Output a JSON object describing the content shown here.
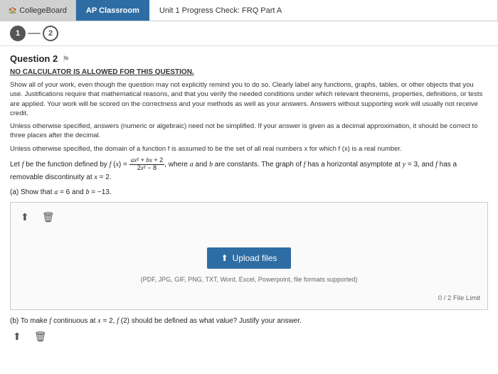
{
  "topbar": {
    "tab1_label": "CollegeBoard",
    "tab2_label": "AP Classroom",
    "tab3_label": "Unit 1 Progress Check: FRQ Part A"
  },
  "steps": {
    "step1_label": "1",
    "step2_label": "2"
  },
  "question": {
    "number": "Question 2",
    "no_calc": "NO CALCULATOR IS ALLOWED FOR THIS QUESTION.",
    "instruction1": "Show all of your work, even though the question may not explicitly remind you to do so. Clearly label any functions, graphs, tables, or other objects that you use. Justifications require that mathematical reasons, and that you verify the needed conditions under which relevant theorems, properties, definitions, or tests are applied. Your work will be scored on the correctness and your methods as well as your answers. Answers without supporting work will usually not receive credit.",
    "instruction2": "Unless otherwise specified, answers (numeric or algebraic) need not be simplified. If your answer is given as a decimal approximation, it should be correct to three places after the decimal.",
    "instruction3": "Unless otherwise specified, the domain of a function f is assumed to be the set of all real numbers x for which f (x) is a real number.",
    "function_desc": "Let f be the function defined by f (x) = (ax² + bx + 2) / (2x² - 8), where a and b are constants. The graph of f has a horizontal asymptote at y = 3, and f has a removable discontinuity at x = 2.",
    "part_a_label": "(a) Show that a = 6 and b = −13.",
    "part_b_label": "(b) To make f continuous at x = 2, f (2) should be defined as what value? Justify your answer."
  },
  "upload": {
    "btn_label": "Upload files",
    "formats_text": "(PDF, JPG, GIF, PNG, TXT, Word, Excel, Powerpoint, file formats supported)",
    "file_limit": "0 / 2 File Limit",
    "upload_icon": "⬆"
  }
}
